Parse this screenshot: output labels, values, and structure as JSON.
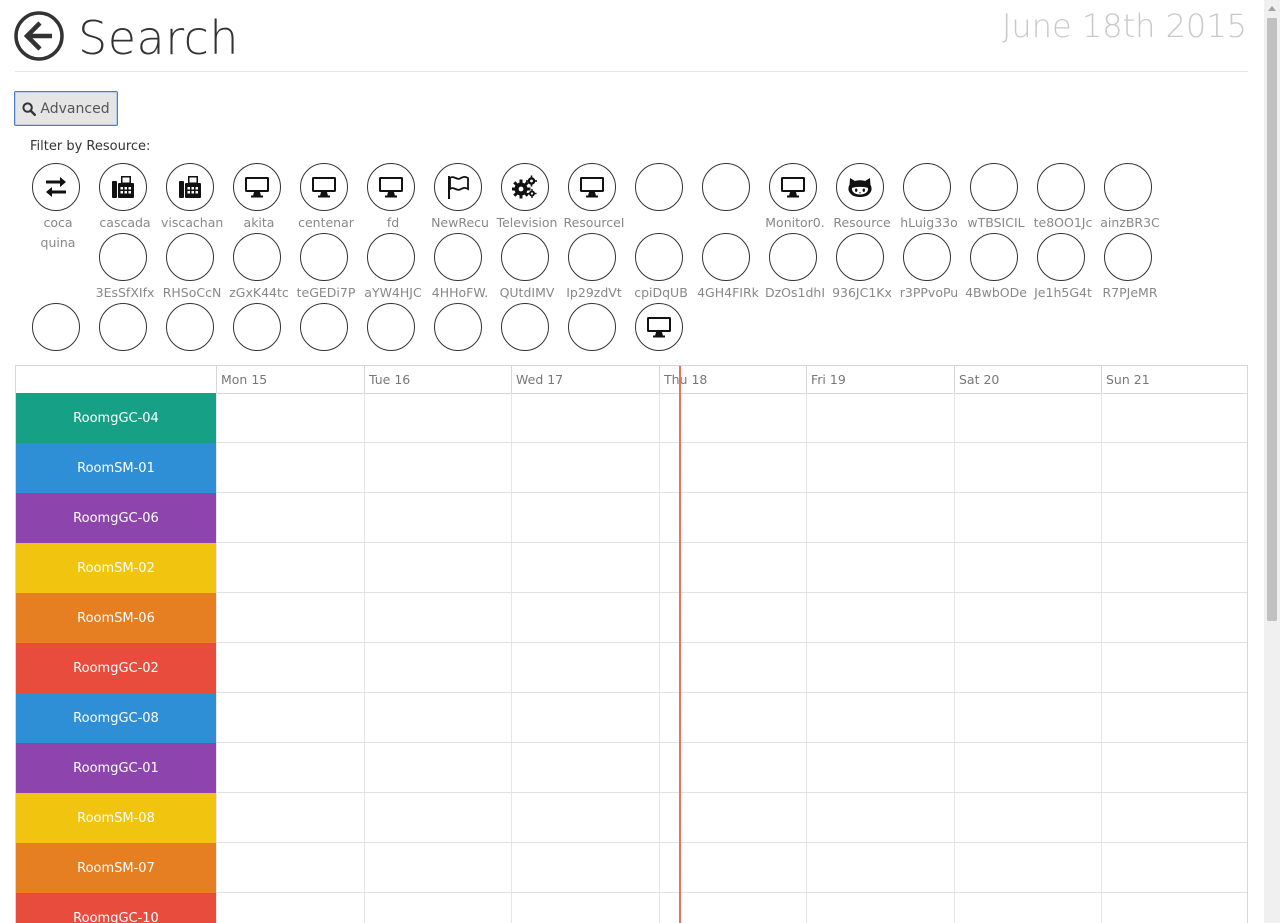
{
  "header": {
    "title": "Search",
    "date": "June 18th 2015"
  },
  "advanced": {
    "label": "Advanced"
  },
  "filter": {
    "label": "Filter by Resource:"
  },
  "resources": [
    {
      "label": "coca quina",
      "icon": "arrows-exchange-icon"
    },
    {
      "label": "cascada",
      "icon": "fax-icon"
    },
    {
      "label": "viscachan",
      "icon": "fax-icon"
    },
    {
      "label": "akita",
      "icon": "monitor-icon"
    },
    {
      "label": "centenar",
      "icon": "monitor-icon"
    },
    {
      "label": "fd",
      "icon": "monitor-icon"
    },
    {
      "label": "NewRecu",
      "icon": "flag-icon"
    },
    {
      "label": "Television",
      "icon": "gears-icon"
    },
    {
      "label": "ResourceI",
      "icon": "monitor-icon"
    },
    {
      "label": "",
      "icon": ""
    },
    {
      "label": "",
      "icon": ""
    },
    {
      "label": "Monitor0.",
      "icon": "monitor-icon"
    },
    {
      "label": "Resource",
      "icon": "github-cat-icon"
    },
    {
      "label": "hLuig33o",
      "icon": ""
    },
    {
      "label": "wTBSICIL",
      "icon": ""
    },
    {
      "label": "te8OO1Jc",
      "icon": ""
    },
    {
      "label": "ainzBR3C",
      "icon": ""
    },
    {
      "label": "3EsSfXIfx",
      "icon": ""
    },
    {
      "label": "RHSoCcN",
      "icon": ""
    },
    {
      "label": "zGxK44tc",
      "icon": ""
    },
    {
      "label": "teGEDi7P",
      "icon": ""
    },
    {
      "label": "aYW4HJC",
      "icon": ""
    },
    {
      "label": "4HHoFW.",
      "icon": ""
    },
    {
      "label": "QUtdIMV",
      "icon": ""
    },
    {
      "label": "Ip29zdVt",
      "icon": ""
    },
    {
      "label": "cpiDqUB",
      "icon": ""
    },
    {
      "label": "4GH4FIRk",
      "icon": ""
    },
    {
      "label": "DzOs1dhI",
      "icon": ""
    },
    {
      "label": "936JC1Kx",
      "icon": ""
    },
    {
      "label": "r3PPvoPu",
      "icon": ""
    },
    {
      "label": "4BwbODe",
      "icon": ""
    },
    {
      "label": "Je1h5G4t",
      "icon": ""
    },
    {
      "label": "R7PJeMR",
      "icon": ""
    },
    {
      "label": "",
      "icon": ""
    },
    {
      "label": "",
      "icon": ""
    },
    {
      "label": "",
      "icon": ""
    },
    {
      "label": "",
      "icon": ""
    },
    {
      "label": "",
      "icon": ""
    },
    {
      "label": "",
      "icon": ""
    },
    {
      "label": "",
      "icon": ""
    },
    {
      "label": "",
      "icon": ""
    },
    {
      "label": "",
      "icon": ""
    },
    {
      "label": "",
      "icon": "monitor-icon"
    }
  ],
  "calendar": {
    "days": [
      "Mon 15",
      "Tue 16",
      "Wed 17",
      "Thu 18",
      "Fri 19",
      "Sat 20",
      "Sun 21"
    ],
    "rooms": [
      {
        "name": "RoomgGC-04",
        "color": "#16a085"
      },
      {
        "name": "RoomSM-01",
        "color": "#2e8fd6"
      },
      {
        "name": "RoomgGC-06",
        "color": "#8e44ad"
      },
      {
        "name": "RoomSM-02",
        "color": "#f1c40f"
      },
      {
        "name": "RoomSM-06",
        "color": "#e67e22"
      },
      {
        "name": "RoomgGC-02",
        "color": "#e74c3c"
      },
      {
        "name": "RoomgGC-08",
        "color": "#2e8fd6"
      },
      {
        "name": "RoomgGC-01",
        "color": "#8e44ad"
      },
      {
        "name": "RoomSM-08",
        "color": "#f1c40f"
      },
      {
        "name": "RoomSM-07",
        "color": "#e67e22"
      },
      {
        "name": "RoomgGC-10",
        "color": "#e74c3c"
      }
    ]
  }
}
